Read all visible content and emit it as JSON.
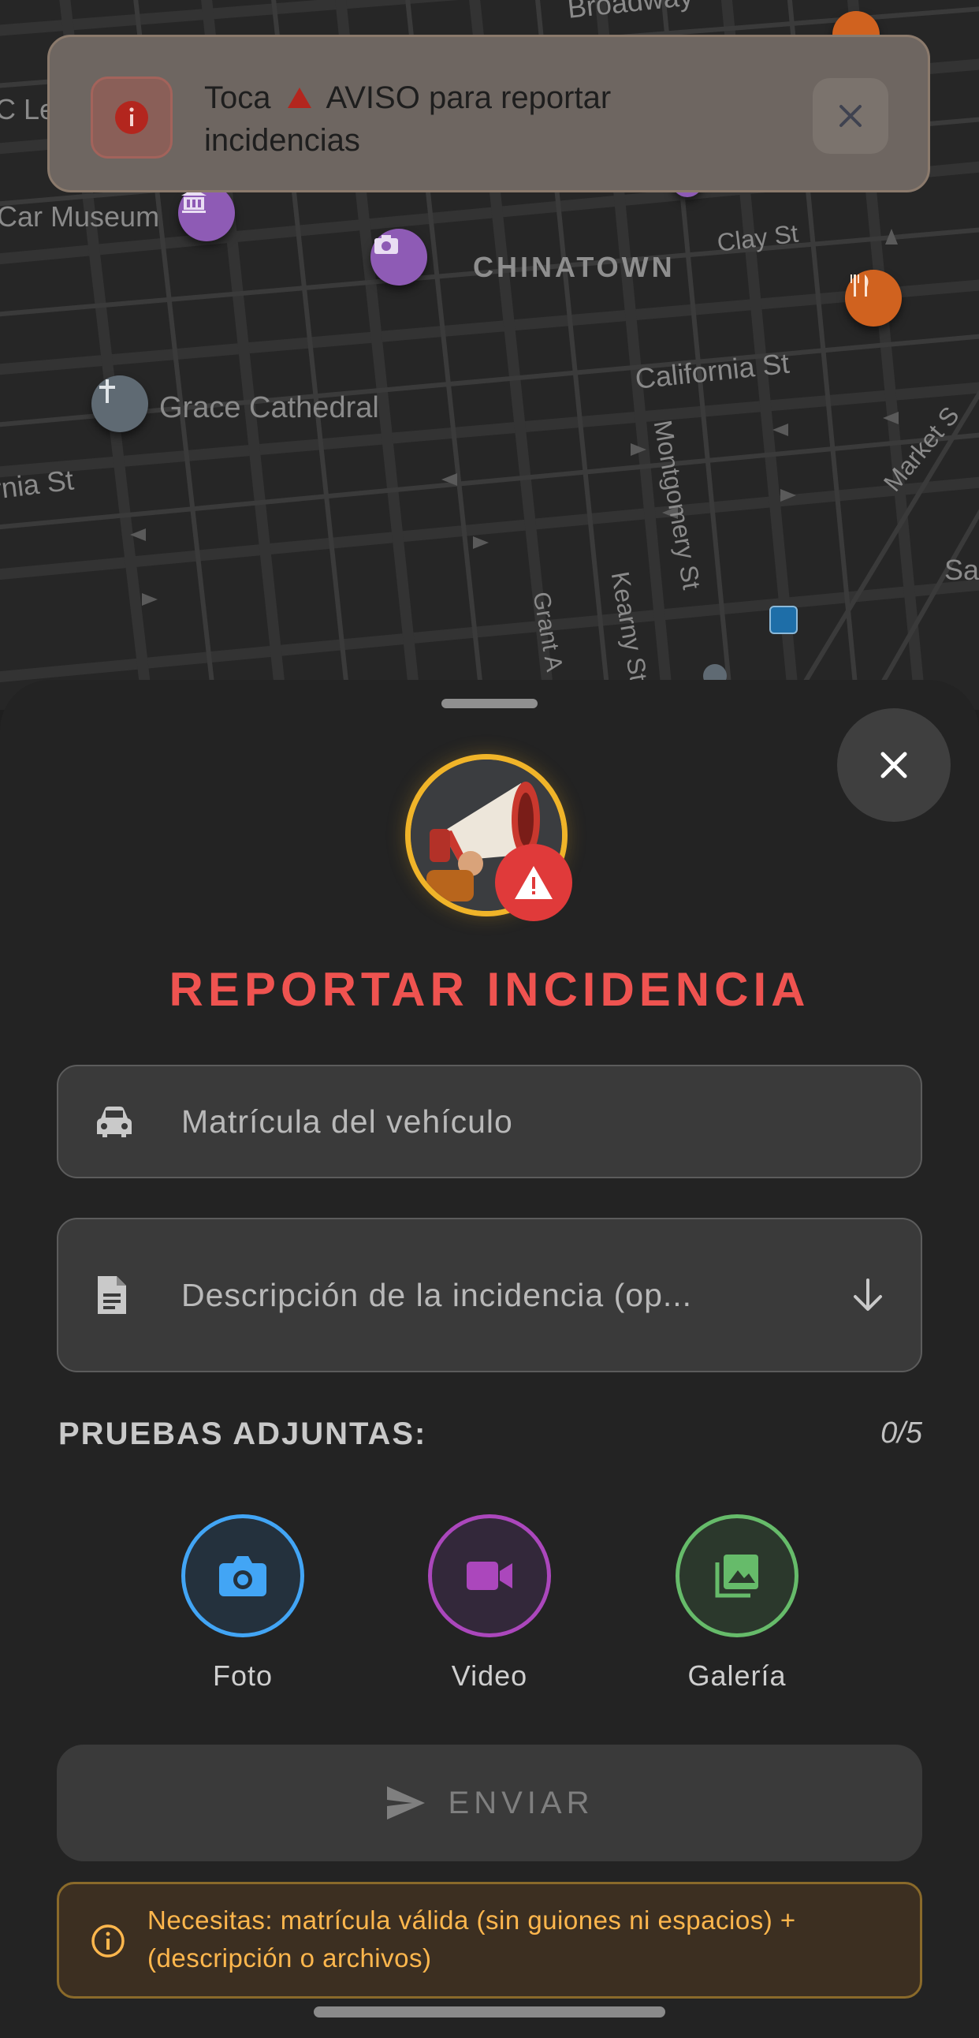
{
  "map": {
    "district": "CHINATOWN",
    "labels": {
      "broadway": "Broadway",
      "car_museum": "Car Museum",
      "clay_st": "Clay St",
      "california_st": "California St",
      "grace_cathedral": "Grace Cathedral",
      "california_left": "rnia St",
      "montgomery": "Montgomery St",
      "kearny": "Kearny St",
      "grant": "Grant A",
      "market": "Market S",
      "sa": "Sa",
      "c_le": "C Le"
    },
    "pins": [
      {
        "name": "museum-pin-icon",
        "color": "#8e5bb5"
      },
      {
        "name": "camera-pin-icon",
        "color": "#8e5bb5"
      },
      {
        "name": "restaurant-pin-icon",
        "color": "#d0621f"
      },
      {
        "name": "church-pin-icon",
        "color": "#5f6a73"
      }
    ]
  },
  "toast": {
    "message_prefix": "Toca",
    "message_suffix": "AVISO para reportar incidencias",
    "icon": "info-icon",
    "close_icon": "close-icon"
  },
  "sheet": {
    "title": "REPORTAR INCIDENCIA",
    "plate_placeholder": "Matrícula del vehículo",
    "description_placeholder": "Descripción de la incidencia (op...",
    "evidence_label": "PRUEBAS ADJUNTAS:",
    "evidence_count": "0/5",
    "attachments": [
      {
        "label": "Foto",
        "icon": "camera-icon",
        "color": "#42a5f5"
      },
      {
        "label": "Video",
        "icon": "video-icon",
        "color": "#ab47bc"
      },
      {
        "label": "Galería",
        "icon": "gallery-icon",
        "color": "#66bb6a"
      }
    ],
    "send_label": "ENVIAR",
    "warning": "Necesitas: matrícula válida (sin guiones ni espacios) + (descripción o archivos)"
  },
  "colors": {
    "accent_red": "#ef5350",
    "avatar_ring": "#f0b429",
    "warning_text": "#ffb74d"
  }
}
